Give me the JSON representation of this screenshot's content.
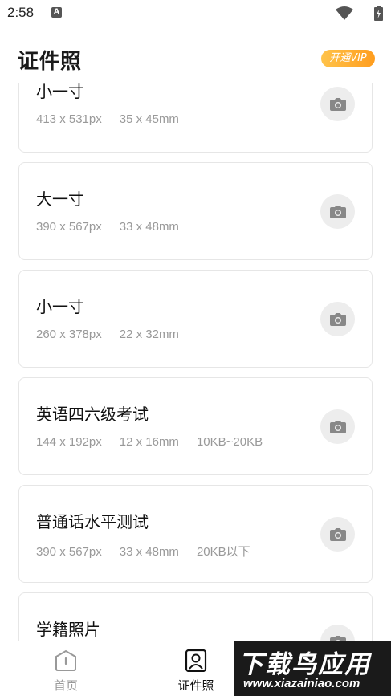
{
  "status": {
    "time": "2:58",
    "app_icon_glyph": "A"
  },
  "header": {
    "title": "证件照",
    "vip_label": "开通VIP"
  },
  "cards": [
    {
      "title": "小一寸",
      "pixels": "413 x 531px",
      "mm": "35 x 45mm",
      "extra": ""
    },
    {
      "title": "大一寸",
      "pixels": "390 x 567px",
      "mm": "33 x 48mm",
      "extra": ""
    },
    {
      "title": "小一寸",
      "pixels": "260 x 378px",
      "mm": "22 x 32mm",
      "extra": ""
    },
    {
      "title": "英语四六级考试",
      "pixels": "144 x 192px",
      "mm": "12 x 16mm",
      "extra": "10KB~20KB"
    },
    {
      "title": "普通话水平测试",
      "pixels": "390 x 567px",
      "mm": "33 x 48mm",
      "extra": "20KB以下"
    },
    {
      "title": "学籍照片",
      "pixels": "",
      "mm": "",
      "extra": ""
    }
  ],
  "tabs": {
    "home_label": "首页",
    "id_label": "证件照"
  },
  "watermark": {
    "top": "下载鸟应用",
    "bottom": "www.xiazainiao.com"
  },
  "colors": {
    "vip_gradient_start": "#ffc34a",
    "vip_gradient_end": "#ff9d1e",
    "spec_text": "#999999",
    "card_border": "#e6e6e6"
  },
  "icons": {
    "card_action": "camera-icon",
    "tab_home": "home-info-icon",
    "tab_id": "id-portrait-icon"
  }
}
